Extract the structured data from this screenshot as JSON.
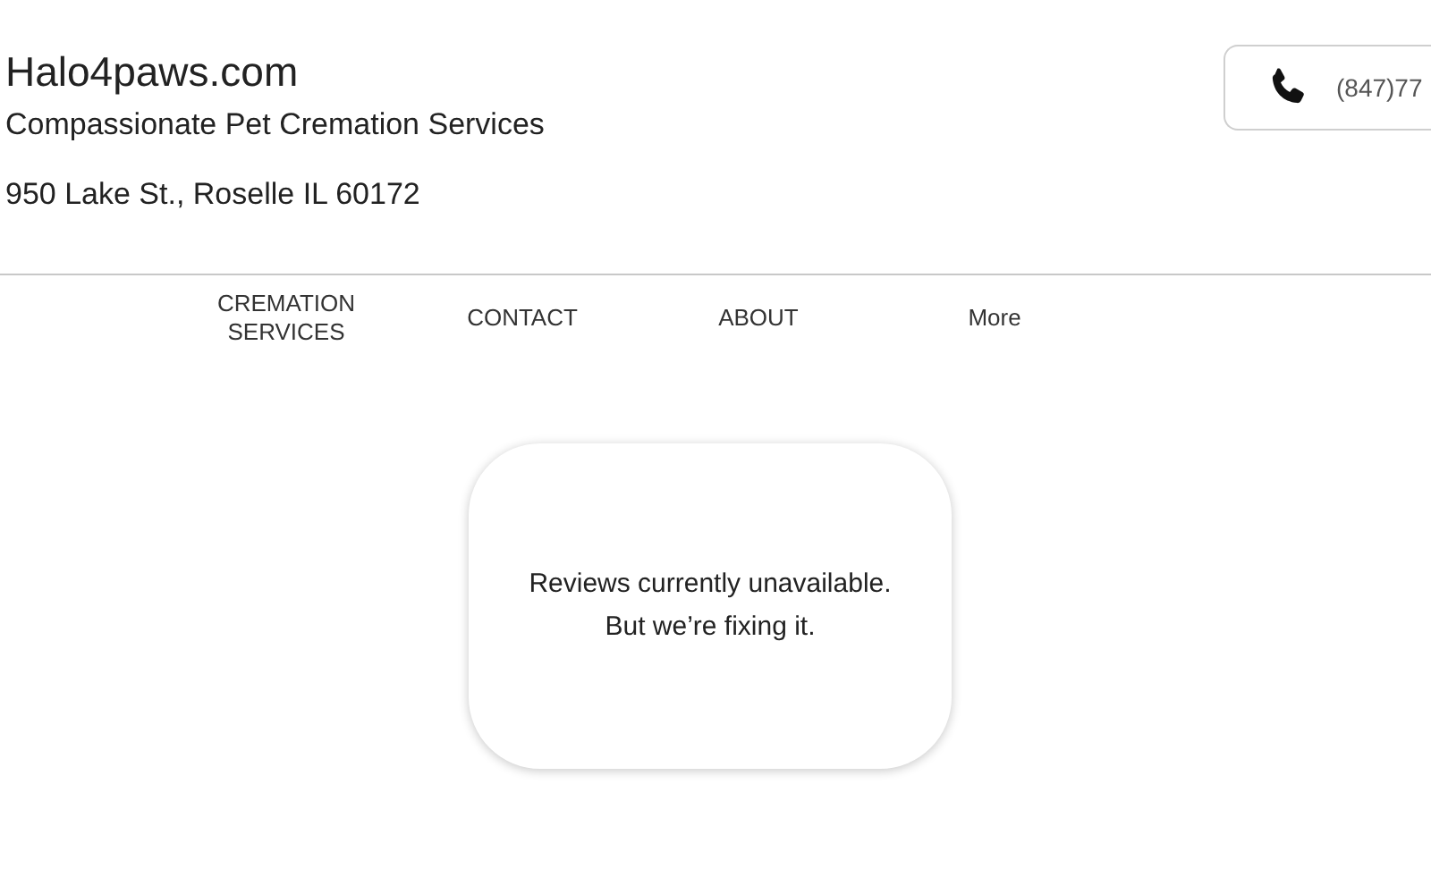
{
  "header": {
    "site_name": "Halo4paws.com",
    "tagline": "Compassionate Pet Cremation Services",
    "address": "950 Lake St., Roselle IL 60172",
    "phone": "(847)77"
  },
  "nav": [
    {
      "label": "CREMATION\nSERVICES"
    },
    {
      "label": "CONTACT"
    },
    {
      "label": "ABOUT"
    },
    {
      "label": "More"
    }
  ],
  "reviews": {
    "lines": [
      "Reviews currently unavailable.",
      "But we’re fixing it."
    ]
  }
}
